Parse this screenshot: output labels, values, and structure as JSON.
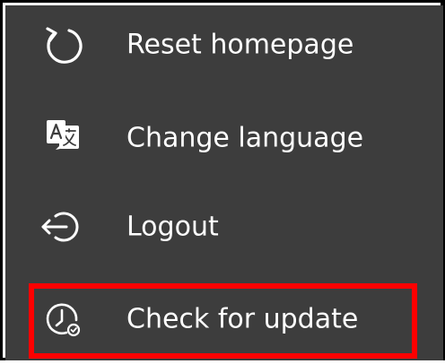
{
  "colors": {
    "menu_background": "#3d3d3d",
    "text": "#ffffff",
    "highlight": "#ff0000"
  },
  "menu": {
    "items": [
      {
        "label": "Reset homepage",
        "icon": "reset-icon"
      },
      {
        "label": "Change language",
        "icon": "language-icon"
      },
      {
        "label": "Logout",
        "icon": "logout-icon"
      },
      {
        "label": "Check for update",
        "icon": "check-update-icon"
      }
    ],
    "highlighted_item": "Check for update"
  }
}
